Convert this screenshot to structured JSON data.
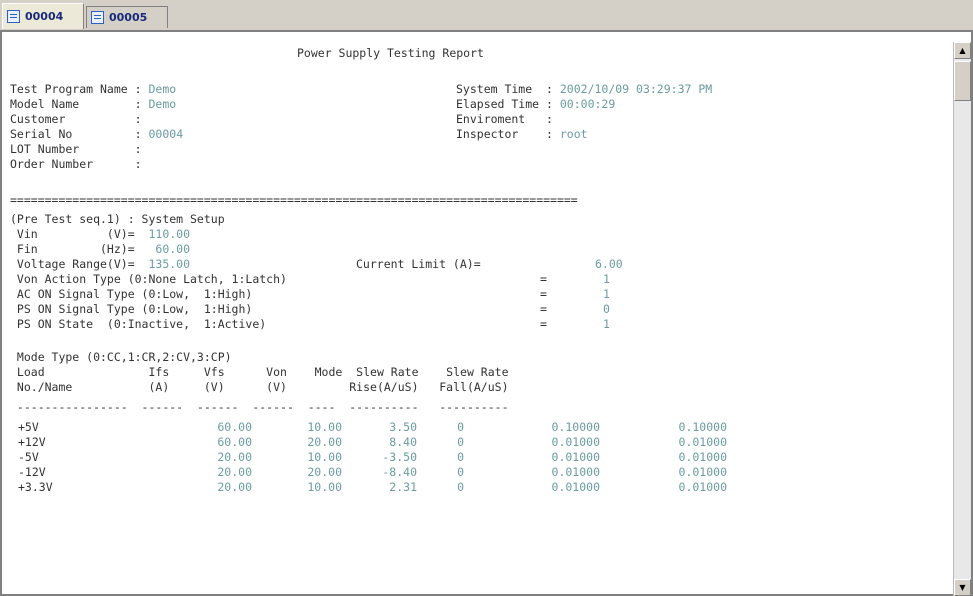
{
  "tabs": [
    {
      "label": "00004",
      "active": true
    },
    {
      "label": "00005",
      "active": false
    }
  ],
  "report": {
    "title": "Power Supply Testing Report",
    "header_left": [
      {
        "label": "Test Program Name :",
        "value": "Demo"
      },
      {
        "label": "Model Name        :",
        "value": "Demo"
      },
      {
        "label": "Customer          :",
        "value": ""
      },
      {
        "label": "Serial No         :",
        "value": "00004"
      },
      {
        "label": "LOT Number        :",
        "value": ""
      },
      {
        "label": "Order Number      :",
        "value": ""
      }
    ],
    "header_right": [
      {
        "label": "System Time  :",
        "value": "2002/10/09 03:29:37 PM"
      },
      {
        "label": "Elapsed Time :",
        "value": "00:00:29"
      },
      {
        "label": "Enviroment   :",
        "value": ""
      },
      {
        "label": "Inspector    :",
        "value": "root"
      }
    ],
    "separator": "==================================================================================",
    "section_title": "(Pre Test seq.1) : System Setup",
    "vin_label": " Vin          (V)=",
    "vin_value": "  110.00",
    "fin_label": " Fin         (Hz)=",
    "fin_value": "   60.00",
    "vrange_label": " Voltage Range(V)=",
    "vrange_value": "  135.00",
    "climit_label": "Current Limit (A)=",
    "climit_value": "6.00",
    "settings": [
      {
        "label": " Von Action Type (0:None Latch, 1:Latch)",
        "value": "1"
      },
      {
        "label": " AC ON Signal Type (0:Low,  1:High)",
        "value": "1"
      },
      {
        "label": " PS ON Signal Type (0:Low,  1:High)",
        "value": "0"
      },
      {
        "label": " PS ON State  (0:Inactive,  1:Active)",
        "value": "1"
      }
    ],
    "mode_type": " Mode Type (0:CC,1:CR,2:CV,3:CP)",
    "table_head1": " Load               Ifs     Vfs      Von    Mode  Slew Rate    Slew Rate",
    "table_head2": " No./Name           (A)     (V)      (V)         Rise(A/uS)   Fall(A/uS)",
    "table_dash": " ----------------  ------  ------  ------  ----  ----------   ----------",
    "rows": [
      {
        "name": "+5V",
        "ifs": "60.00",
        "vfs": "10.00",
        "von": "3.50",
        "mode": "0",
        "rise": "0.10000",
        "fall": "0.10000"
      },
      {
        "name": "+12V",
        "ifs": "60.00",
        "vfs": "20.00",
        "von": "8.40",
        "mode": "0",
        "rise": "0.01000",
        "fall": "0.01000"
      },
      {
        "name": "-5V",
        "ifs": "20.00",
        "vfs": "10.00",
        "von": "-3.50",
        "mode": "0",
        "rise": "0.01000",
        "fall": "0.01000"
      },
      {
        "name": "-12V",
        "ifs": "20.00",
        "vfs": "20.00",
        "von": "-8.40",
        "mode": "0",
        "rise": "0.01000",
        "fall": "0.01000"
      },
      {
        "name": "+3.3V",
        "ifs": "20.00",
        "vfs": "10.00",
        "von": "2.31",
        "mode": "0",
        "rise": "0.01000",
        "fall": "0.01000"
      }
    ]
  },
  "scrollbar": {
    "up": "▲",
    "down": "▼"
  }
}
